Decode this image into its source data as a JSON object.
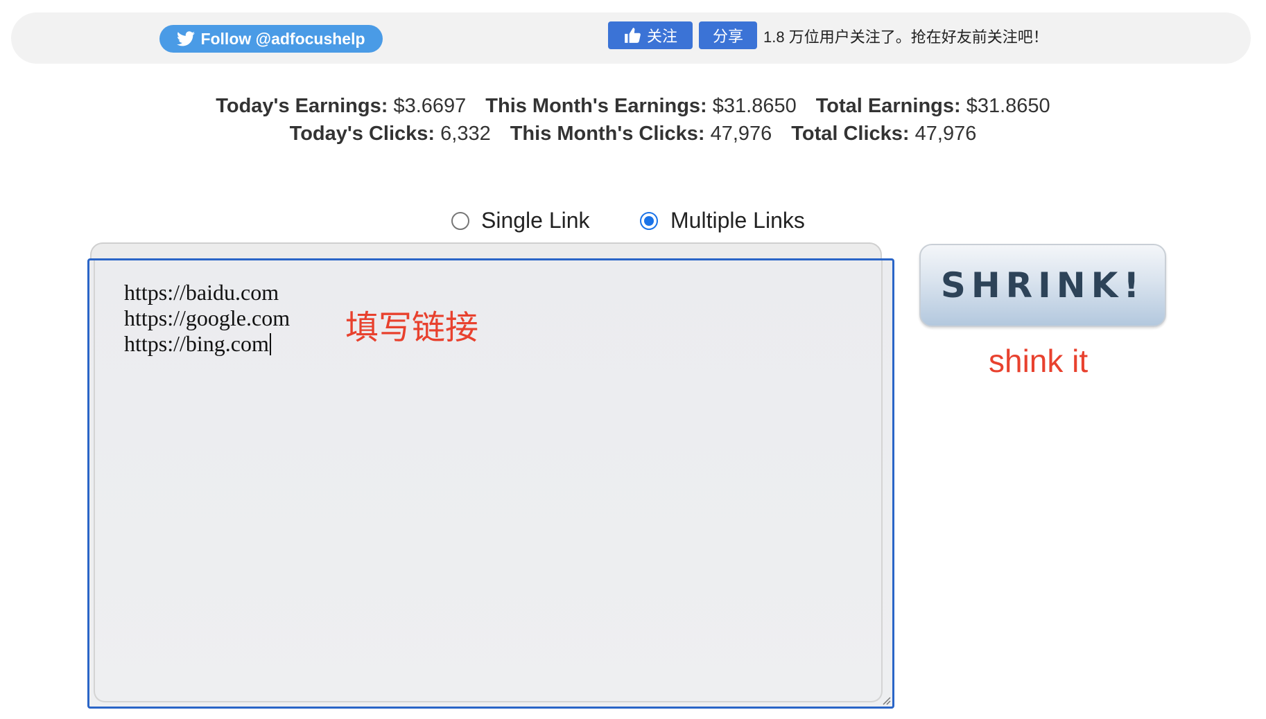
{
  "social": {
    "twitter_label": "Follow @adfocushelp",
    "fb_like_label": "关注",
    "fb_share_label": "分享",
    "fb_count_text": "1.8 万位用户关注了。抢在好友前关注吧！"
  },
  "stats": {
    "today_earnings_label": "Today's Earnings:",
    "today_earnings_value": "$3.6697",
    "month_earnings_label": "This Month's Earnings:",
    "month_earnings_value": "$31.8650",
    "total_earnings_label": "Total Earnings:",
    "total_earnings_value": "$31.8650",
    "today_clicks_label": "Today's Clicks:",
    "today_clicks_value": "6,332",
    "month_clicks_label": "This Month's Clicks:",
    "month_clicks_value": "47,976",
    "total_clicks_label": "Total Clicks:",
    "total_clicks_value": "47,976"
  },
  "mode": {
    "single_label": "Single Link",
    "multiple_label": "Multiple Links",
    "selected": "multiple"
  },
  "links_input": {
    "lines": [
      "https://baidu.com",
      "https://google.com",
      "https://bing.com"
    ]
  },
  "annotations": {
    "fill_links": "填写链接",
    "shrink_it": "shink it"
  },
  "shrink_button": {
    "label": "SHRINK!"
  },
  "colors": {
    "twitter_blue": "#4a9be6",
    "facebook_blue": "#3b73d6",
    "annotation_red": "#e8412e",
    "focus_border": "#2a65c7"
  }
}
